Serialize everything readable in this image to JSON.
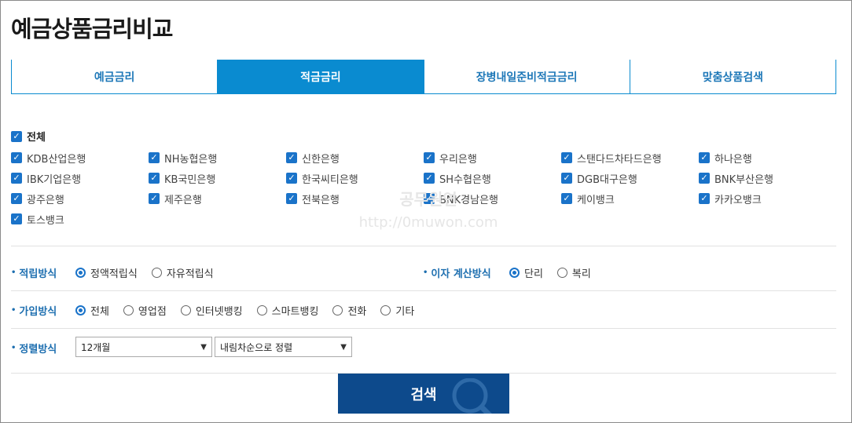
{
  "page_title": "예금상품금리비교",
  "tabs": [
    {
      "label": "예금금리",
      "active": false
    },
    {
      "label": "적금금리",
      "active": true
    },
    {
      "label": "장병내일준비적금금리",
      "active": false
    },
    {
      "label": "맞춤상품검색",
      "active": false
    }
  ],
  "banks": {
    "all_label": "전체",
    "items": [
      "KDB산업은행",
      "NH농협은행",
      "신한은행",
      "우리은행",
      "스탠다드차타드은행",
      "하나은행",
      "IBK기업은행",
      "KB국민은행",
      "한국씨티은행",
      "SH수협은행",
      "DGB대구은행",
      "BNK부산은행",
      "광주은행",
      "제주은행",
      "전북은행",
      "BNK경남은행",
      "케이뱅크",
      "카카오뱅크",
      "토스뱅크"
    ]
  },
  "watermark": {
    "text": "공무원연",
    "url": "http://0muwon.com"
  },
  "savings_method": {
    "label": "적립방식",
    "options": [
      {
        "label": "정액적립식",
        "checked": true
      },
      {
        "label": "자유적립식",
        "checked": false
      }
    ]
  },
  "interest_method": {
    "label": "이자 계산방식",
    "options": [
      {
        "label": "단리",
        "checked": true
      },
      {
        "label": "복리",
        "checked": false
      }
    ]
  },
  "join_method": {
    "label": "가입방식",
    "options": [
      {
        "label": "전체",
        "checked": true
      },
      {
        "label": "영업점",
        "checked": false
      },
      {
        "label": "인터넷뱅킹",
        "checked": false
      },
      {
        "label": "스마트뱅킹",
        "checked": false
      },
      {
        "label": "전화",
        "checked": false
      },
      {
        "label": "기타",
        "checked": false
      }
    ]
  },
  "sort": {
    "label": "정렬방식",
    "period_value": "12개월",
    "order_value": "내림차순으로 정렬"
  },
  "search_button": "검색",
  "colors": {
    "accent": "#0a8bd0",
    "button": "#0d4a8c",
    "checkbox": "#1a73c9"
  }
}
